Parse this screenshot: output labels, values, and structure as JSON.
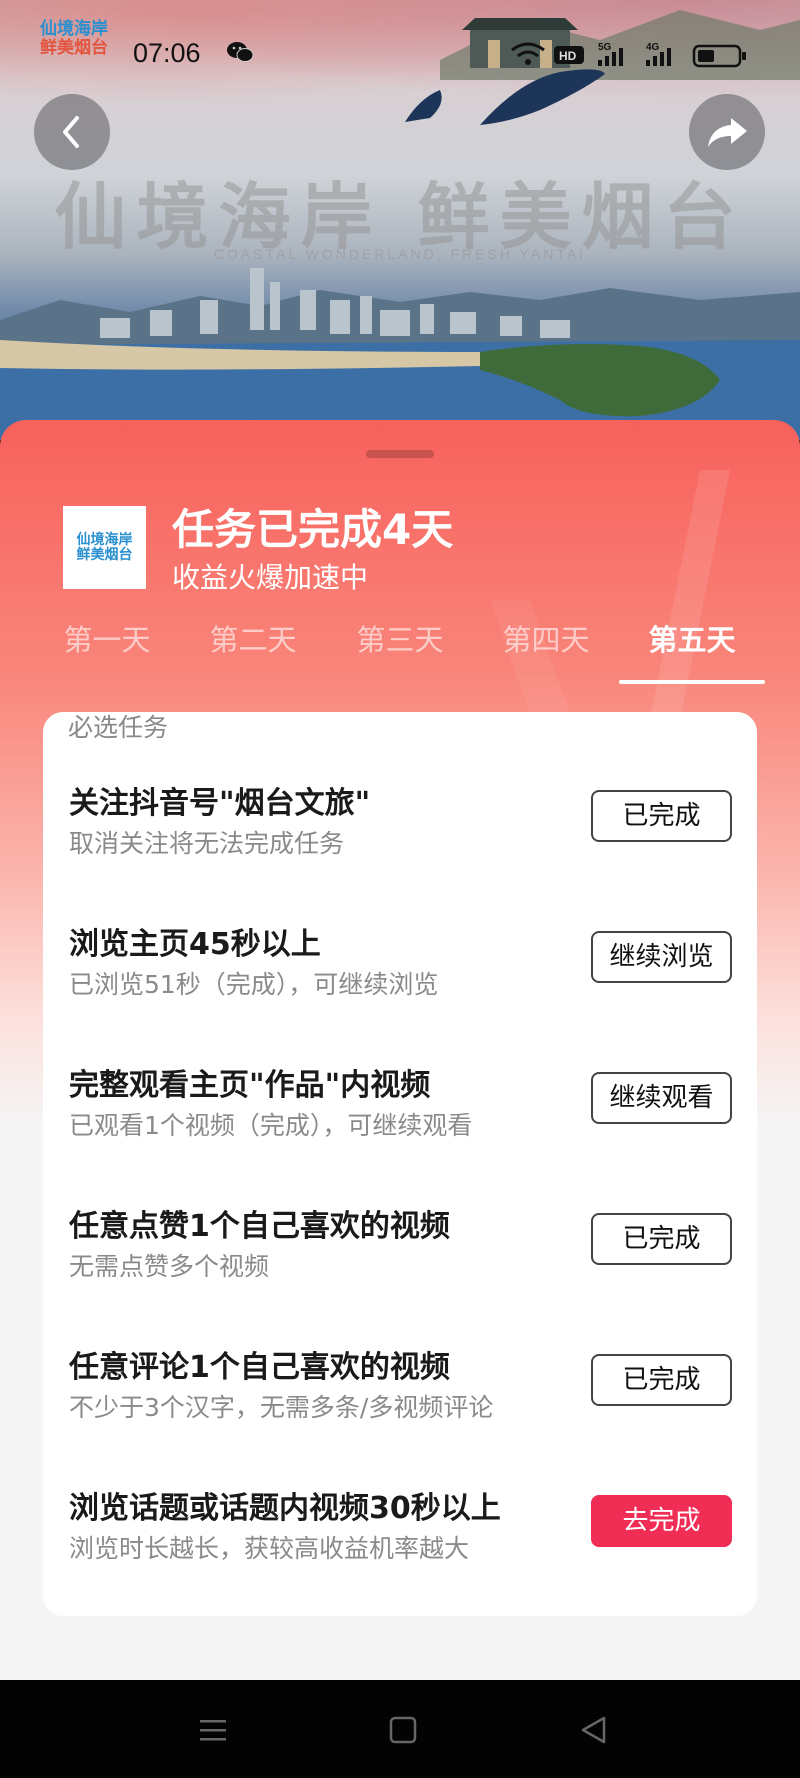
{
  "status_bar": {
    "time": "07:06",
    "icons": [
      "wechat-icon",
      "wifi-icon",
      "hd-icon",
      "5g-signal-icon",
      "4g-signal-icon",
      "battery-icon"
    ]
  },
  "hero": {
    "logo_line1": "仙境海岸",
    "logo_line2": "鲜美烟台",
    "slogan": "仙境海岸 鲜美烟台",
    "slogan_en": "COASTAL WONDERLAND, FRESH YANTAI"
  },
  "sheet": {
    "app_icon_text_line1": "仙境海岸",
    "app_icon_text_line2": "鲜美烟台",
    "title": "任务已完成4天",
    "subtitle": "收益火爆加速中",
    "tabs": [
      {
        "label": "第一天"
      },
      {
        "label": "第二天"
      },
      {
        "label": "第三天"
      },
      {
        "label": "第四天"
      },
      {
        "label": "第五天",
        "active": true
      }
    ]
  },
  "tasks": {
    "heading": "必选任务",
    "items": [
      {
        "title": "关注抖音号\"烟台文旅\"",
        "desc": "取消关注将无法完成任务",
        "button": "已完成"
      },
      {
        "title": "浏览主页45秒以上",
        "desc": "已浏览51秒（完成），可继续浏览",
        "button": "继续浏览"
      },
      {
        "title": "完整观看主页\"作品\"内视频",
        "desc": "已观看1个视频（完成），可继续观看",
        "button": "继续观看"
      },
      {
        "title": "任意点赞1个自己喜欢的视频",
        "desc": "无需点赞多个视频",
        "button": "已完成"
      },
      {
        "title": "任意评论1个自己喜欢的视频",
        "desc": "不少于3个汉字，无需多条/多视频评论",
        "button": "已完成"
      },
      {
        "title": "浏览话题或话题内视频30秒以上",
        "desc": "浏览时长越长，获较高收益机率越大",
        "button": "去完成"
      }
    ]
  },
  "colors": {
    "accent_button": "#f02d55",
    "sheet_top": "#f7615c"
  }
}
